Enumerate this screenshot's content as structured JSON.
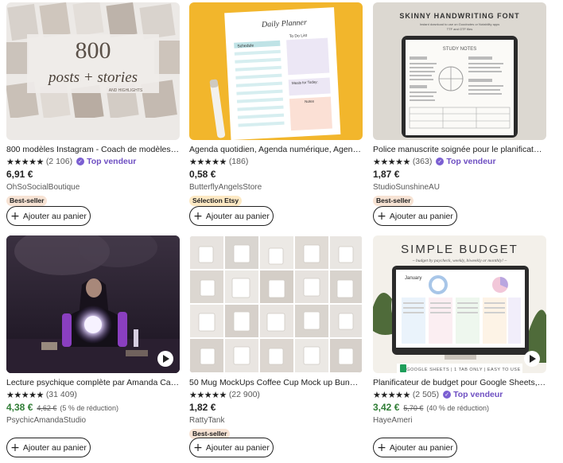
{
  "products": [
    {
      "title": "800 modèles Instagram - Coach de modèles in...",
      "stars": "★★★★★",
      "reviews": "(2 106)",
      "top_seller": "Top vendeur",
      "price": "6,91 €",
      "shop": "OhSoSocialBoutique",
      "badge": "Best-seller",
      "add_label": "Ajouter au panier",
      "thumb": {
        "big": "800",
        "script": "posts + stories",
        "small": "AND HIGHLIGHTS"
      }
    },
    {
      "title": "Agenda quotidien, Agenda numérique, Agenda...",
      "stars": "★★★★★",
      "reviews": "(186)",
      "price": "0,58 €",
      "shop": "ButterflyAngelsStore",
      "badge": "Sélection Etsy",
      "add_label": "Ajouter au panier",
      "thumb": {
        "heading": "Daily Planner",
        "col_left": "Schedule",
        "col_right": "To Do List",
        "note1": "Meals for Today:",
        "note2": "Notes"
      }
    },
    {
      "title": "Police manuscrite soignée pour le planificateur...",
      "stars": "★★★★★",
      "reviews": "(363)",
      "top_seller": "Top vendeur",
      "price": "1,87 €",
      "shop": "StudioSunshineAU",
      "badge": "Best-seller",
      "add_label": "Ajouter au panier",
      "thumb": {
        "heading": "SKINNY HANDWRITING FONT",
        "sub1": "Instant download to use on Goodnotes or Notability apps",
        "sub2": "TTF and OTF files",
        "notes": "STUDY NOTES"
      }
    },
    {
      "title": "Lecture psychique complète par Amanda Cart...",
      "stars": "★★★★★",
      "reviews": "(31 409)",
      "price": "4,38 €",
      "orig_price": "4,62 €",
      "discount": "(5 % de réduction)",
      "shop": "PsychicAmandaStudio",
      "add_label": "Ajouter au panier"
    },
    {
      "title": "50 Mug MockUps Coffee Cup Mock up Bundle ...",
      "stars": "★★★★★",
      "reviews": "(22 900)",
      "price": "1,82 €",
      "shop": "RattyTank",
      "badge": "Best-seller",
      "add_label": "Ajouter au panier"
    },
    {
      "title": "Planificateur de budget pour Google Sheets, ta...",
      "stars": "★★★★★",
      "reviews": "(2 505)",
      "top_seller": "Top vendeur",
      "price": "3,42 €",
      "orig_price": "5,70 €",
      "discount": "(40 % de réduction)",
      "shop": "HayeAmeri",
      "add_label": "Ajouter au panier",
      "thumb": {
        "heading": "SIMPLE BUDGET",
        "sub": "~ budget by paycheck, weekly, biweekly or monthly! ~",
        "sheet_title": "January",
        "footer": "GOOGLE SHEETS | 1 TAB ONLY | EASY TO USE"
      }
    }
  ],
  "colors": {
    "top_seller": "#6e4fc2",
    "sale_price": "#2f7d35",
    "best_seller_bg": "#f7e3d4",
    "etsy_pick_bg": "#fde9c4"
  }
}
